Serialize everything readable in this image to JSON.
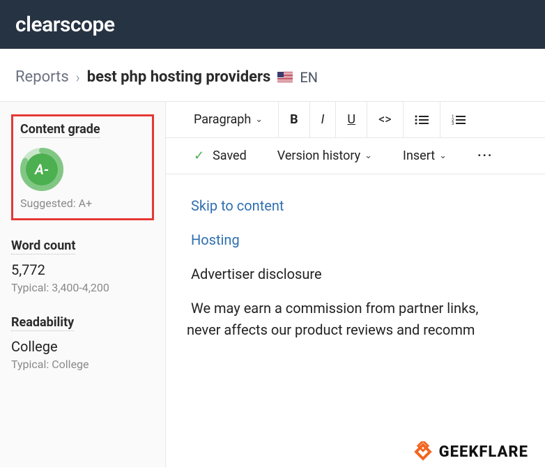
{
  "brand": "clearscope",
  "breadcrumb": {
    "root": "Reports",
    "title": "best php hosting providers",
    "lang": "EN"
  },
  "sidebar": {
    "grade": {
      "title": "Content grade",
      "value": "A-",
      "suggested": "Suggested: A+"
    },
    "wordcount": {
      "title": "Word count",
      "value": "5,772",
      "typical": "Typical: 3,400-4,200"
    },
    "readability": {
      "title": "Readability",
      "value": "College",
      "typical": "Typical: College"
    }
  },
  "toolbar": {
    "paragraph": "Paragraph",
    "saved": "Saved",
    "version": "Version history",
    "insert": "Insert"
  },
  "document": {
    "skip": "Skip to content",
    "hosting": "Hosting",
    "disclosure": "Advertiser disclosure",
    "para1": "We may earn a commission from partner links,",
    "para2": "never affects our product reviews and recomm"
  },
  "watermark": "GEEKFLARE"
}
